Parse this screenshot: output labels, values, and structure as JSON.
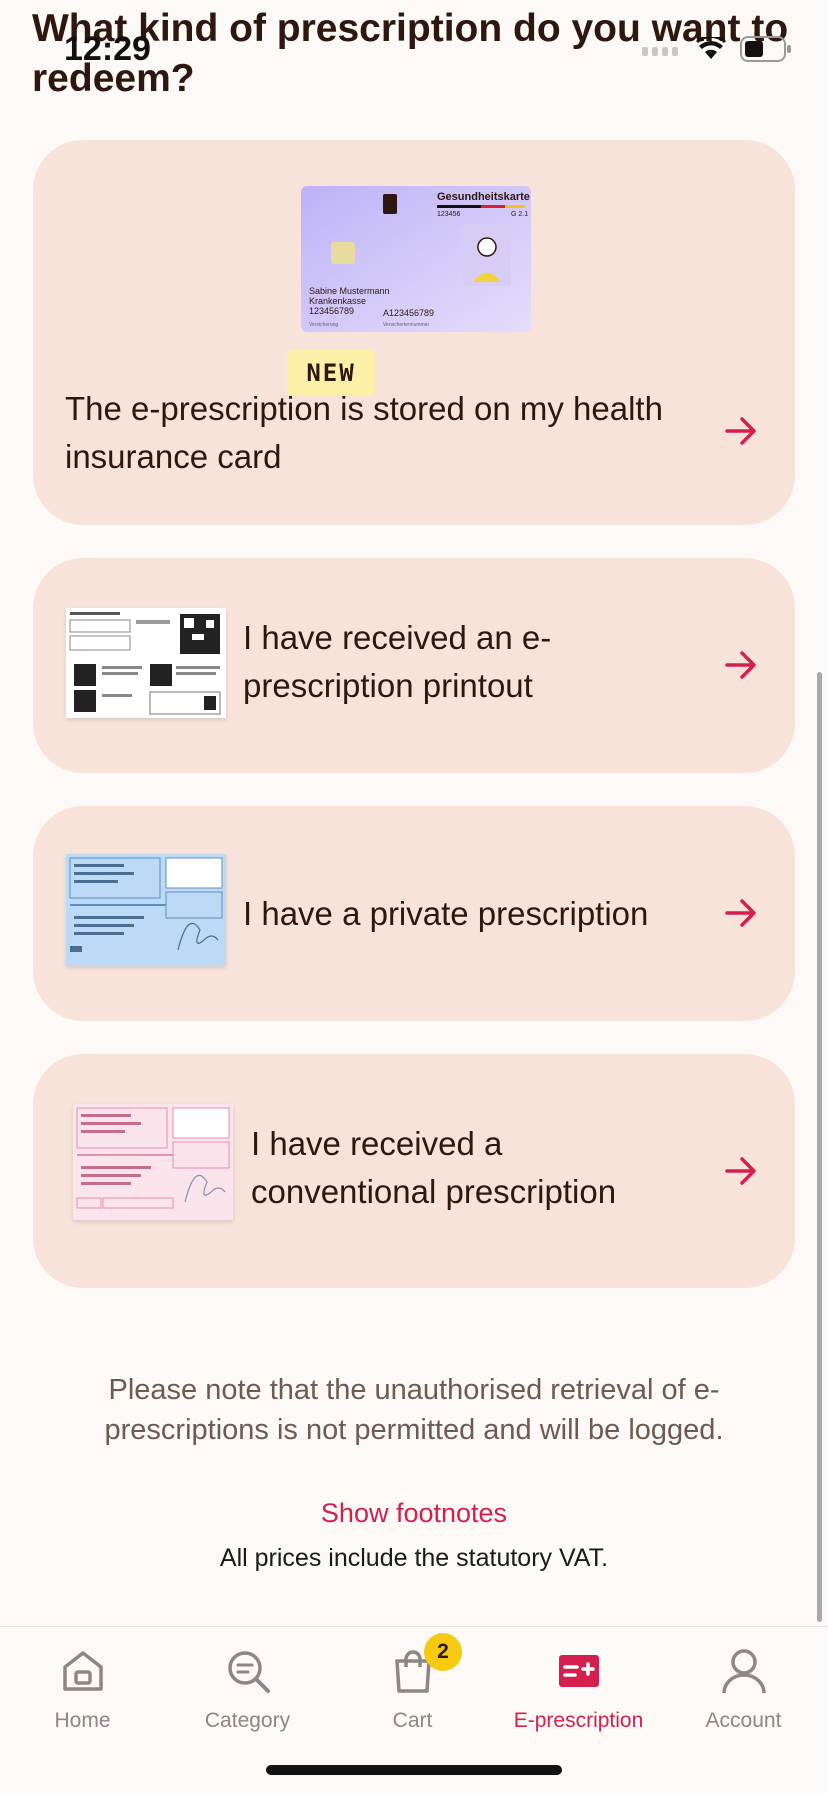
{
  "status": {
    "time": "12:29"
  },
  "page": {
    "title": "What kind of prescription do you want to redeem?"
  },
  "options": [
    {
      "label": "The e-prescription is stored on my health insurance card",
      "badge": "NEW",
      "card_image": {
        "brand": "Gesundheitskarte",
        "number_top": "123456",
        "version": "G 2.1",
        "name": "Sabine Mustermann",
        "insurer": "Krankenkasse",
        "insured_no": "123456789",
        "card_no": "A123456789",
        "caption_left": "Versicherung",
        "caption_right": "Versichertennummer"
      }
    },
    {
      "label": "I have received an e-prescription printout"
    },
    {
      "label": "I have a private prescription"
    },
    {
      "label": "I have received a conventional prescription"
    }
  ],
  "notice": "Please note that the unauthorised retrieval of e-prescriptions is not permitted and will be logged.",
  "footnotes_link": "Show footnotes",
  "vat_note": "All prices include the statutory VAT.",
  "tabbar": {
    "active": "E-prescription",
    "items": [
      {
        "label": "Home",
        "icon": "home-icon"
      },
      {
        "label": "Category",
        "icon": "category-search-icon"
      },
      {
        "label": "Cart",
        "icon": "cart-icon",
        "badge": "2"
      },
      {
        "label": "E-prescription",
        "icon": "prescription-icon"
      },
      {
        "label": "Account",
        "icon": "account-icon"
      }
    ]
  },
  "colors": {
    "accent": "#d3204f",
    "card_bg": "#f8e3da",
    "page_bg": "#fdf9f6",
    "text": "#2d1710",
    "badge_yellow": "#f7c911"
  }
}
